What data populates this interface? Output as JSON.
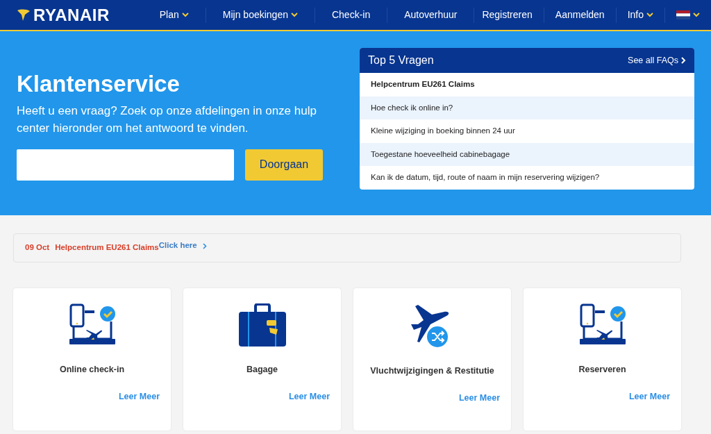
{
  "navbar": {
    "logo": "RYANAIR",
    "left_items": [
      {
        "label": "Plan",
        "dropdown": true
      },
      {
        "label": "Mijn boekingen",
        "dropdown": true
      },
      {
        "label": "Check-in",
        "dropdown": false
      },
      {
        "label": "Autoverhuur",
        "dropdown": false
      }
    ],
    "right_items": [
      {
        "label": "Registreren",
        "dropdown": false
      },
      {
        "label": "Aanmelden",
        "dropdown": false
      },
      {
        "label": "Info",
        "dropdown": true
      }
    ],
    "language_dropdown": true
  },
  "hero": {
    "title": "Klantenservice",
    "subtitle": "Heeft u een vraag? Zoek op onze afdelingen in onze hulp center hieronder om het antwoord te vinden.",
    "search_button": "Doorgaan"
  },
  "faq": {
    "title": "Top 5 Vragen",
    "see_all": "See all FAQs",
    "items": [
      {
        "text": "Helpcentrum EU261 Claims",
        "bold": true
      },
      {
        "text": "Hoe check ik online in?",
        "bold": false
      },
      {
        "text": "Kleine wijziging in boeking binnen 24 uur",
        "bold": false
      },
      {
        "text": "Toegestane hoeveelheid cabinebagage",
        "bold": false
      },
      {
        "text": "Kan ik de datum, tijd, route of naam in mijn reservering wijzigen?",
        "bold": false
      }
    ]
  },
  "notice": {
    "date": "09 Oct",
    "title": "Helpcentrum EU261 Claims",
    "link": "Click here"
  },
  "cards": [
    {
      "kind": "checkin",
      "title": "Online check-in",
      "link": "Leer Meer"
    },
    {
      "kind": "luggage",
      "title": "Bagage",
      "link": "Leer Meer"
    },
    {
      "kind": "flight-change",
      "title": "Vluchtwijzigingen & Restitutie",
      "link": "Leer Meer"
    },
    {
      "kind": "checkin",
      "title": "Reserveren",
      "link": "Leer Meer"
    }
  ]
}
